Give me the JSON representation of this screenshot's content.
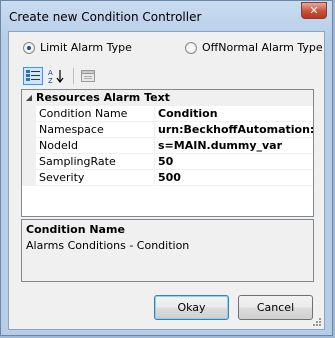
{
  "window": {
    "title": "Create new Condition Controller",
    "close_symbol": "✕"
  },
  "alarm_type": {
    "options": [
      {
        "label": "Limit Alarm Type",
        "checked": true
      },
      {
        "label": "OffNormal Alarm Type",
        "checked": false
      }
    ]
  },
  "toolbar": {
    "buttons": [
      {
        "icon": "categorized-icon",
        "active": true
      },
      {
        "icon": "alphabetical-sort-icon",
        "active": false
      },
      {
        "icon": "property-pages-icon",
        "active": false
      }
    ]
  },
  "property_grid": {
    "category": {
      "label": "Resources Alarm Text",
      "toggle": "◢"
    },
    "rows": [
      {
        "name": "Condition Name",
        "value": "Condition"
      },
      {
        "name": "Namespace",
        "value": "urn:BeckhoffAutomation:Ua"
      },
      {
        "name": "NodeId",
        "value": "s=MAIN.dummy_var"
      },
      {
        "name": "SamplingRate",
        "value": "50"
      },
      {
        "name": "Severity",
        "value": "500"
      }
    ]
  },
  "description": {
    "title": "Condition Name",
    "text": "Alarms  Conditions - Condition"
  },
  "buttons": {
    "okay": "Okay",
    "cancel": "Cancel"
  }
}
